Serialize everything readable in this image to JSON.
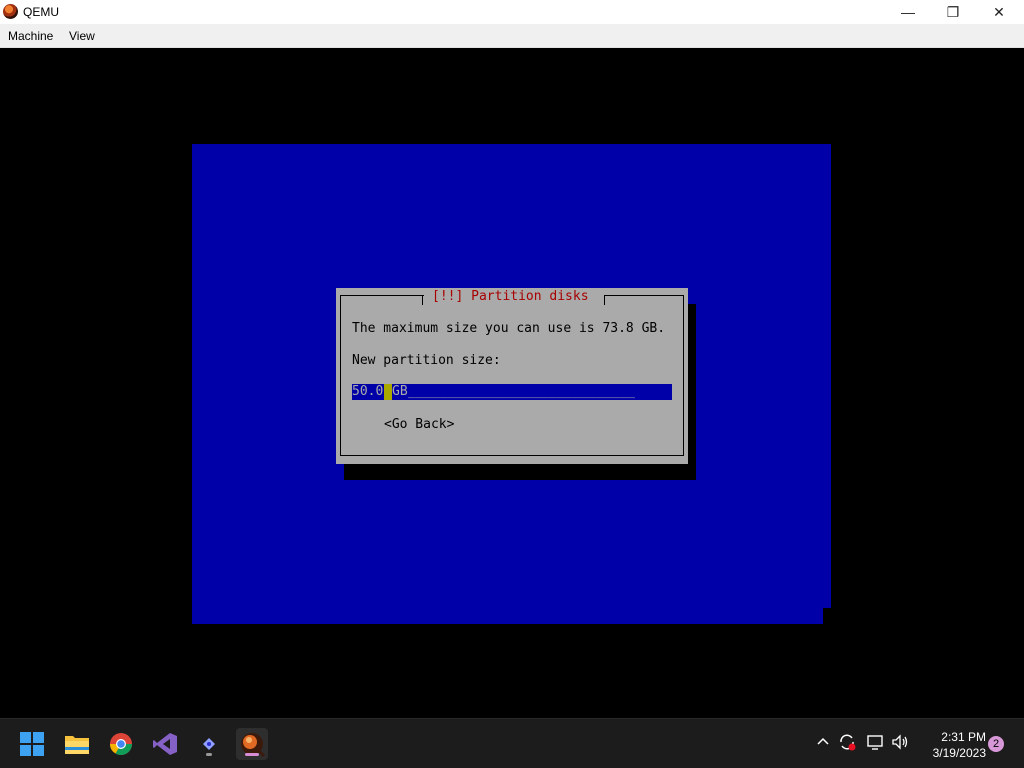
{
  "window": {
    "title": "QEMU",
    "controls": {
      "minimize": "—",
      "restore": "❐",
      "close": "✕"
    }
  },
  "menu": {
    "items": [
      "Machine",
      "View"
    ]
  },
  "installer": {
    "dialog_title": "[!!] Partition disks",
    "message": "The maximum size you can use is 73.8 GB.",
    "prompt": "New partition size:",
    "field_value_before": "50.0",
    "field_value_after": "GB",
    "go_back": "<Go Back>"
  },
  "taskbar": {
    "apps": [
      "start-icon",
      "file-explorer-icon",
      "chrome-icon",
      "visual-studio-icon",
      "app-icon",
      "qemu-icon"
    ],
    "time": "2:31 PM",
    "date": "3/19/2023",
    "notifications": "2"
  },
  "colors": {
    "installer_blue": "#0000a8",
    "dialog_gray": "#aaaaaa",
    "title_red": "#a80000",
    "cursor_yellow": "#a8a800"
  }
}
